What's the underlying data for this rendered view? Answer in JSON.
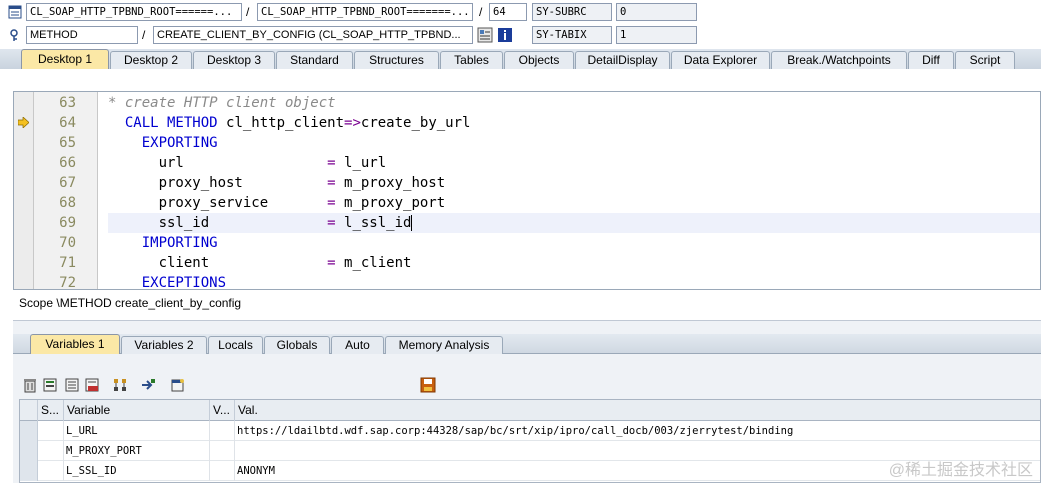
{
  "header": {
    "row1": {
      "program": "CL_SOAP_HTTP_TPBND_ROOT======...",
      "include": "CL_SOAP_HTTP_TPBND_ROOT=======...",
      "line": "64",
      "field_name": "SY-SUBRC",
      "field_value": "0"
    },
    "row2": {
      "event_type": "METHOD",
      "event": "CREATE_CLIENT_BY_CONFIG (CL_SOAP_HTTP_TPBND...",
      "field_name": "SY-TABIX",
      "field_value": "1"
    },
    "separator": "/"
  },
  "desktop_tabs": [
    {
      "label": "Desktop 1",
      "active": true
    },
    {
      "label": "Desktop 2"
    },
    {
      "label": "Desktop 3"
    },
    {
      "label": "Standard"
    },
    {
      "label": "Structures"
    },
    {
      "label": "Tables"
    },
    {
      "label": "Objects"
    },
    {
      "label": "DetailDisplay"
    },
    {
      "label": "Data Explorer"
    },
    {
      "label": "Break./Watchpoints"
    },
    {
      "label": "Diff"
    },
    {
      "label": "Script"
    }
  ],
  "code": {
    "lines": [
      {
        "num": "63",
        "text": "* create HTTP client object"
      },
      {
        "num": "64",
        "text": "  CALL METHOD cl_http_client=>create_by_url"
      },
      {
        "num": "65",
        "text": "    EXPORTING"
      },
      {
        "num": "66",
        "text": "      url                 = l_url"
      },
      {
        "num": "67",
        "text": "      proxy_host          = m_proxy_host"
      },
      {
        "num": "68",
        "text": "      proxy_service       = m_proxy_port"
      },
      {
        "num": "69",
        "text": "      ssl_id              = l_ssl_id"
      },
      {
        "num": "70",
        "text": "    IMPORTING"
      },
      {
        "num": "71",
        "text": "      client              = m_client"
      },
      {
        "num": "72",
        "text": "    EXCEPTIONS"
      }
    ]
  },
  "scope": "Scope \\METHOD create_client_by_config",
  "variable_tabs": [
    {
      "label": "Variables 1",
      "active": true
    },
    {
      "label": "Variables 2"
    },
    {
      "label": "Locals"
    },
    {
      "label": "Globals"
    },
    {
      "label": "Auto"
    },
    {
      "label": "Memory Analysis"
    }
  ],
  "grid": {
    "headers": {
      "s": "S...",
      "variable": "Variable",
      "v": "V...",
      "val": "Val."
    },
    "rows": [
      {
        "variable": "L_URL",
        "val": "https://ldailbtd.wdf.sap.corp:44328/sap/bc/srt/xip/ipro/call_docb/003/zjerrytest/binding"
      },
      {
        "variable": "M_PROXY_PORT",
        "val": ""
      },
      {
        "variable": "L_SSL_ID",
        "val": "ANONYM"
      }
    ]
  },
  "watermark": "@稀土掘金技术社区",
  "colors": {
    "active_tab": "#fbe8a6",
    "keyword": "#0000d0",
    "comment": "#8a8a8a",
    "operator": "#7a0090"
  }
}
